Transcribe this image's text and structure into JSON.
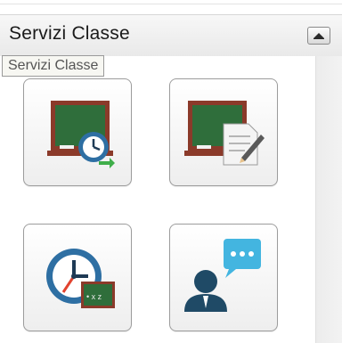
{
  "panel": {
    "title": "Servizi Classe",
    "tooltip": "Servizi Classe",
    "collapse_icon": "chevron-up-icon"
  },
  "tiles": [
    {
      "icon": "blackboard-clock-icon"
    },
    {
      "icon": "blackboard-notes-icon"
    },
    {
      "icon": "clock-blackboard-icon"
    },
    {
      "icon": "person-chat-icon"
    }
  ],
  "colors": {
    "board": "#2f6e3b",
    "board_frame": "#8b3a2a",
    "clock": "#2e6fa3",
    "accent_red": "#e2432f",
    "chat": "#43b5e0",
    "person": "#1f4a66"
  }
}
